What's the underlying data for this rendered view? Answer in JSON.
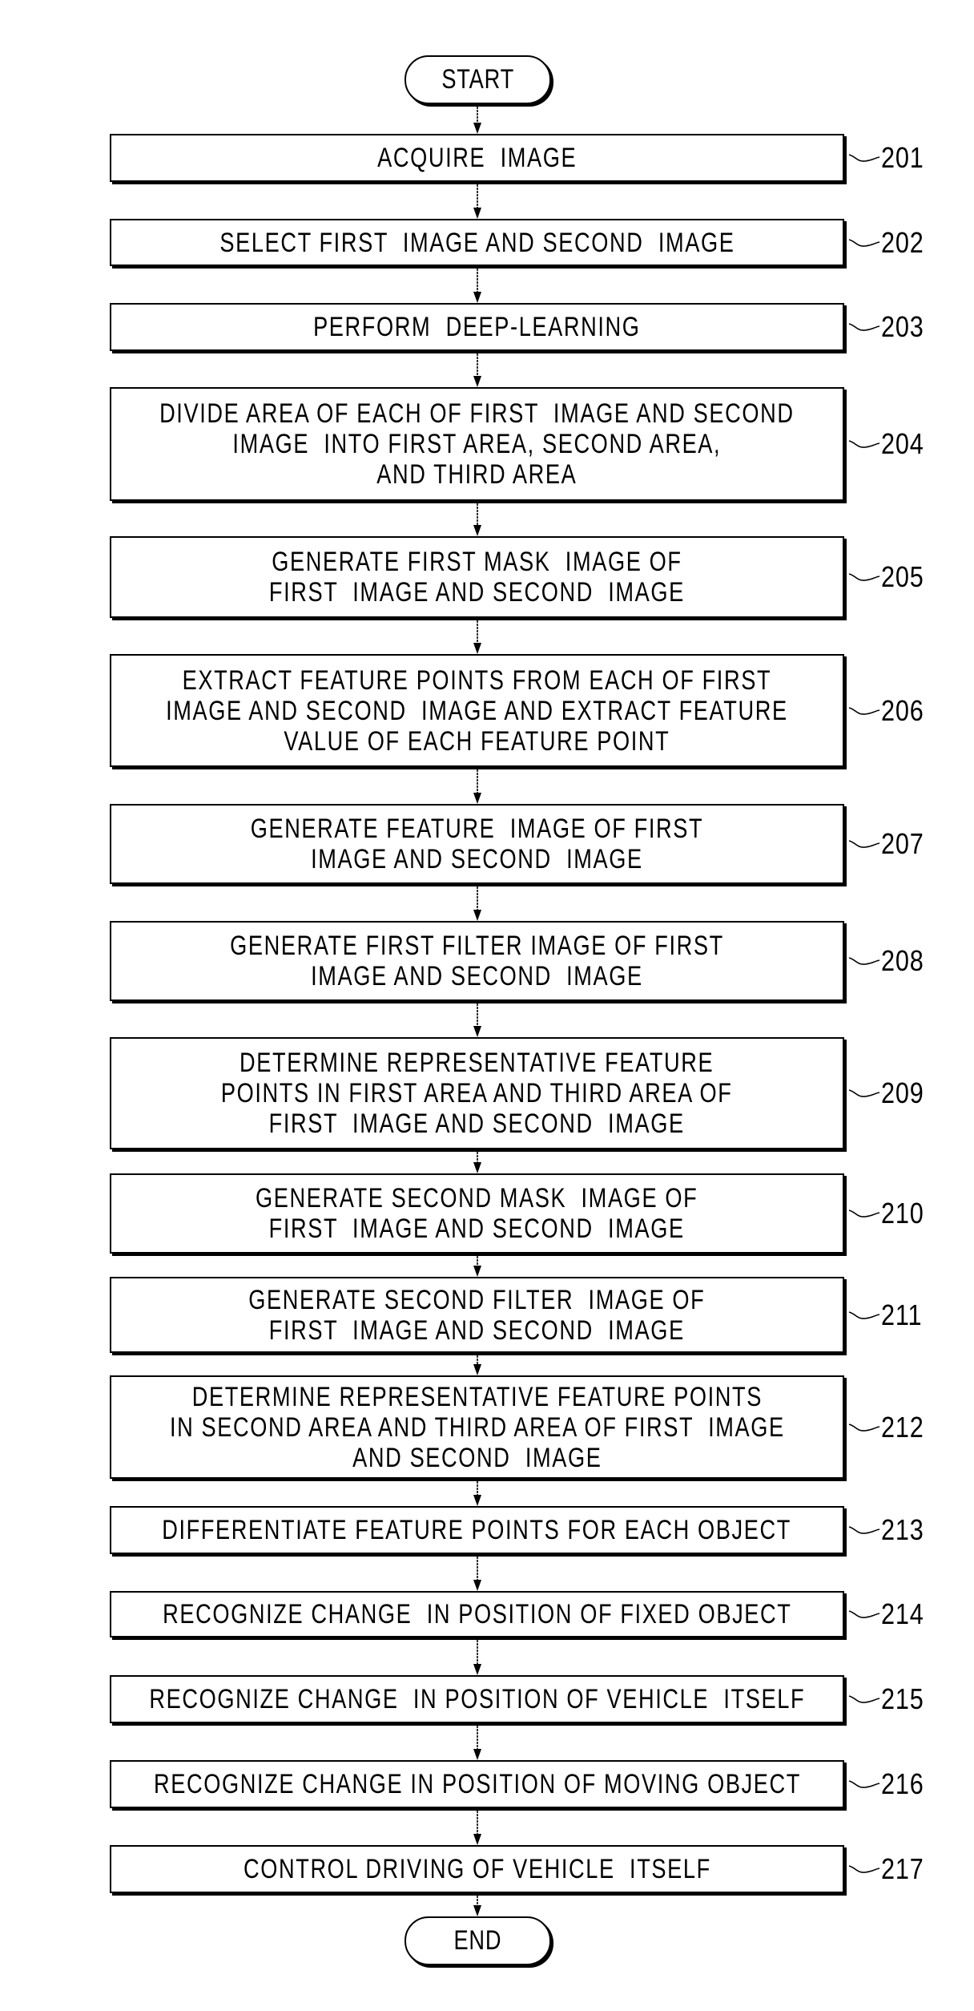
{
  "diagram": {
    "type": "flowchart",
    "start": {
      "label": "START"
    },
    "end": {
      "label": "END"
    },
    "steps": [
      {
        "ref": "201",
        "lines": [
          "ACQUIRE  IMAGE"
        ]
      },
      {
        "ref": "202",
        "lines": [
          "SELECT FIRST  IMAGE AND SECOND  IMAGE"
        ]
      },
      {
        "ref": "203",
        "lines": [
          "PERFORM  DEEP-LEARNING"
        ]
      },
      {
        "ref": "204",
        "lines": [
          "DIVIDE AREA OF EACH OF FIRST  IMAGE AND SECOND",
          "IMAGE  INTO FIRST AREA, SECOND AREA,",
          "AND THIRD AREA"
        ]
      },
      {
        "ref": "205",
        "lines": [
          "GENERATE FIRST MASK  IMAGE OF",
          "FIRST  IMAGE AND SECOND  IMAGE"
        ]
      },
      {
        "ref": "206",
        "lines": [
          "EXTRACT FEATURE POINTS FROM EACH OF FIRST",
          "IMAGE AND SECOND  IMAGE AND EXTRACT FEATURE",
          "VALUE OF EACH FEATURE POINT"
        ]
      },
      {
        "ref": "207",
        "lines": [
          "GENERATE FEATURE  IMAGE OF FIRST",
          "IMAGE AND SECOND  IMAGE"
        ]
      },
      {
        "ref": "208",
        "lines": [
          "GENERATE FIRST FILTER IMAGE OF FIRST",
          "IMAGE AND SECOND  IMAGE"
        ]
      },
      {
        "ref": "209",
        "lines": [
          "DETERMINE REPRESENTATIVE FEATURE",
          "POINTS IN FIRST AREA AND THIRD AREA OF",
          "FIRST  IMAGE AND SECOND  IMAGE"
        ]
      },
      {
        "ref": "210",
        "lines": [
          "GENERATE SECOND MASK  IMAGE OF",
          "FIRST  IMAGE AND SECOND  IMAGE"
        ]
      },
      {
        "ref": "211",
        "lines": [
          "GENERATE SECOND FILTER  IMAGE OF",
          "FIRST  IMAGE AND SECOND  IMAGE"
        ]
      },
      {
        "ref": "212",
        "lines": [
          "DETERMINE REPRESENTATIVE FEATURE POINTS",
          "IN SECOND AREA AND THIRD AREA OF FIRST  IMAGE",
          "AND SECOND  IMAGE"
        ]
      },
      {
        "ref": "213",
        "lines": [
          "DIFFERENTIATE FEATURE POINTS FOR EACH OBJECT"
        ]
      },
      {
        "ref": "214",
        "lines": [
          "RECOGNIZE CHANGE  IN POSITION OF FIXED OBJECT"
        ]
      },
      {
        "ref": "215",
        "lines": [
          "RECOGNIZE CHANGE  IN POSITION OF VEHICLE  ITSELF"
        ]
      },
      {
        "ref": "216",
        "lines": [
          "RECOGNIZE CHANGE IN POSITION OF MOVING OBJECT"
        ]
      },
      {
        "ref": "217",
        "lines": [
          "CONTROL DRIVING OF VEHICLE  ITSELF"
        ]
      }
    ]
  }
}
